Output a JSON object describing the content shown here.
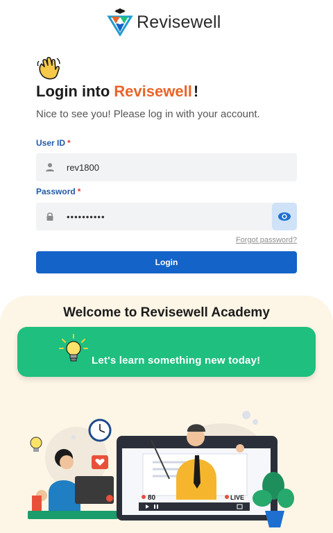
{
  "brand": {
    "name": "Revisewell"
  },
  "login": {
    "title_prefix": "Login into",
    "title_brand": "Revisewell",
    "title_suffix": "!",
    "subtitle": "Nice to see you! Please log in with your account.",
    "user_label": "User ID",
    "user_value": "rev1800",
    "password_label": "Password",
    "password_value": "••••••••••",
    "required_marker": "*",
    "forgot_label": "Forgot password?",
    "login_label": "Login"
  },
  "academy": {
    "title": "Welcome to Revisewell Academy",
    "banner_text": "Let's learn something new today!"
  },
  "video": {
    "viewers": "80",
    "live_label": "LIVE"
  },
  "colors": {
    "accent_orange": "#e8642a",
    "primary_blue": "#1363c8",
    "banner_green": "#1fbf7f",
    "label_blue": "#1e5aa8",
    "required_red": "#e53935"
  },
  "icons": [
    "logo-icon",
    "waving-hand-icon",
    "user-icon",
    "lock-icon",
    "eye-icon",
    "lightbulb-icon",
    "clock-icon",
    "heart-icon",
    "play-icon",
    "pause-icon",
    "fullscreen-icon"
  ]
}
